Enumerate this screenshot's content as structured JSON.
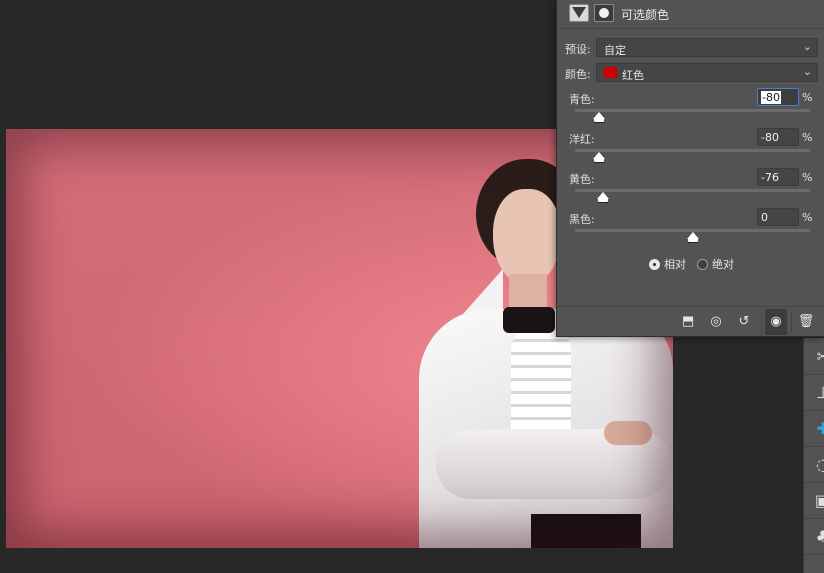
{
  "properties_panel": {
    "title": "可选颜色",
    "preset_label": "预设:",
    "preset_value": "自定",
    "colors_label": "颜色:",
    "colors_value": "红色",
    "colors_swatch": "#cc0000",
    "sliders": [
      {
        "label": "青色:",
        "value": "-80",
        "unit": "%",
        "level": -80
      },
      {
        "label": "洋红:",
        "value": "-80",
        "unit": "%",
        "level": -80
      },
      {
        "label": "黄色:",
        "value": "-76",
        "unit": "%",
        "level": -76
      },
      {
        "label": "黑色:",
        "value": "0",
        "unit": "%",
        "level": 0
      }
    ],
    "method_options": [
      {
        "label": "相对",
        "selected": true
      },
      {
        "label": "绝对",
        "selected": false
      }
    ],
    "footer_icons": [
      "clip-to-layer-icon",
      "view-previous-icon",
      "reset-icon",
      "visibility-eye-icon",
      "trash-icon"
    ]
  },
  "toolbar": {
    "tools": [
      "crop-icon",
      "slice-icon",
      "healing-brush-icon",
      "lasso-icon",
      "image-icon",
      "stamp-icon"
    ],
    "active_color": "#2fa6e6"
  },
  "canvas": {
    "background_color": "#d46e79"
  }
}
